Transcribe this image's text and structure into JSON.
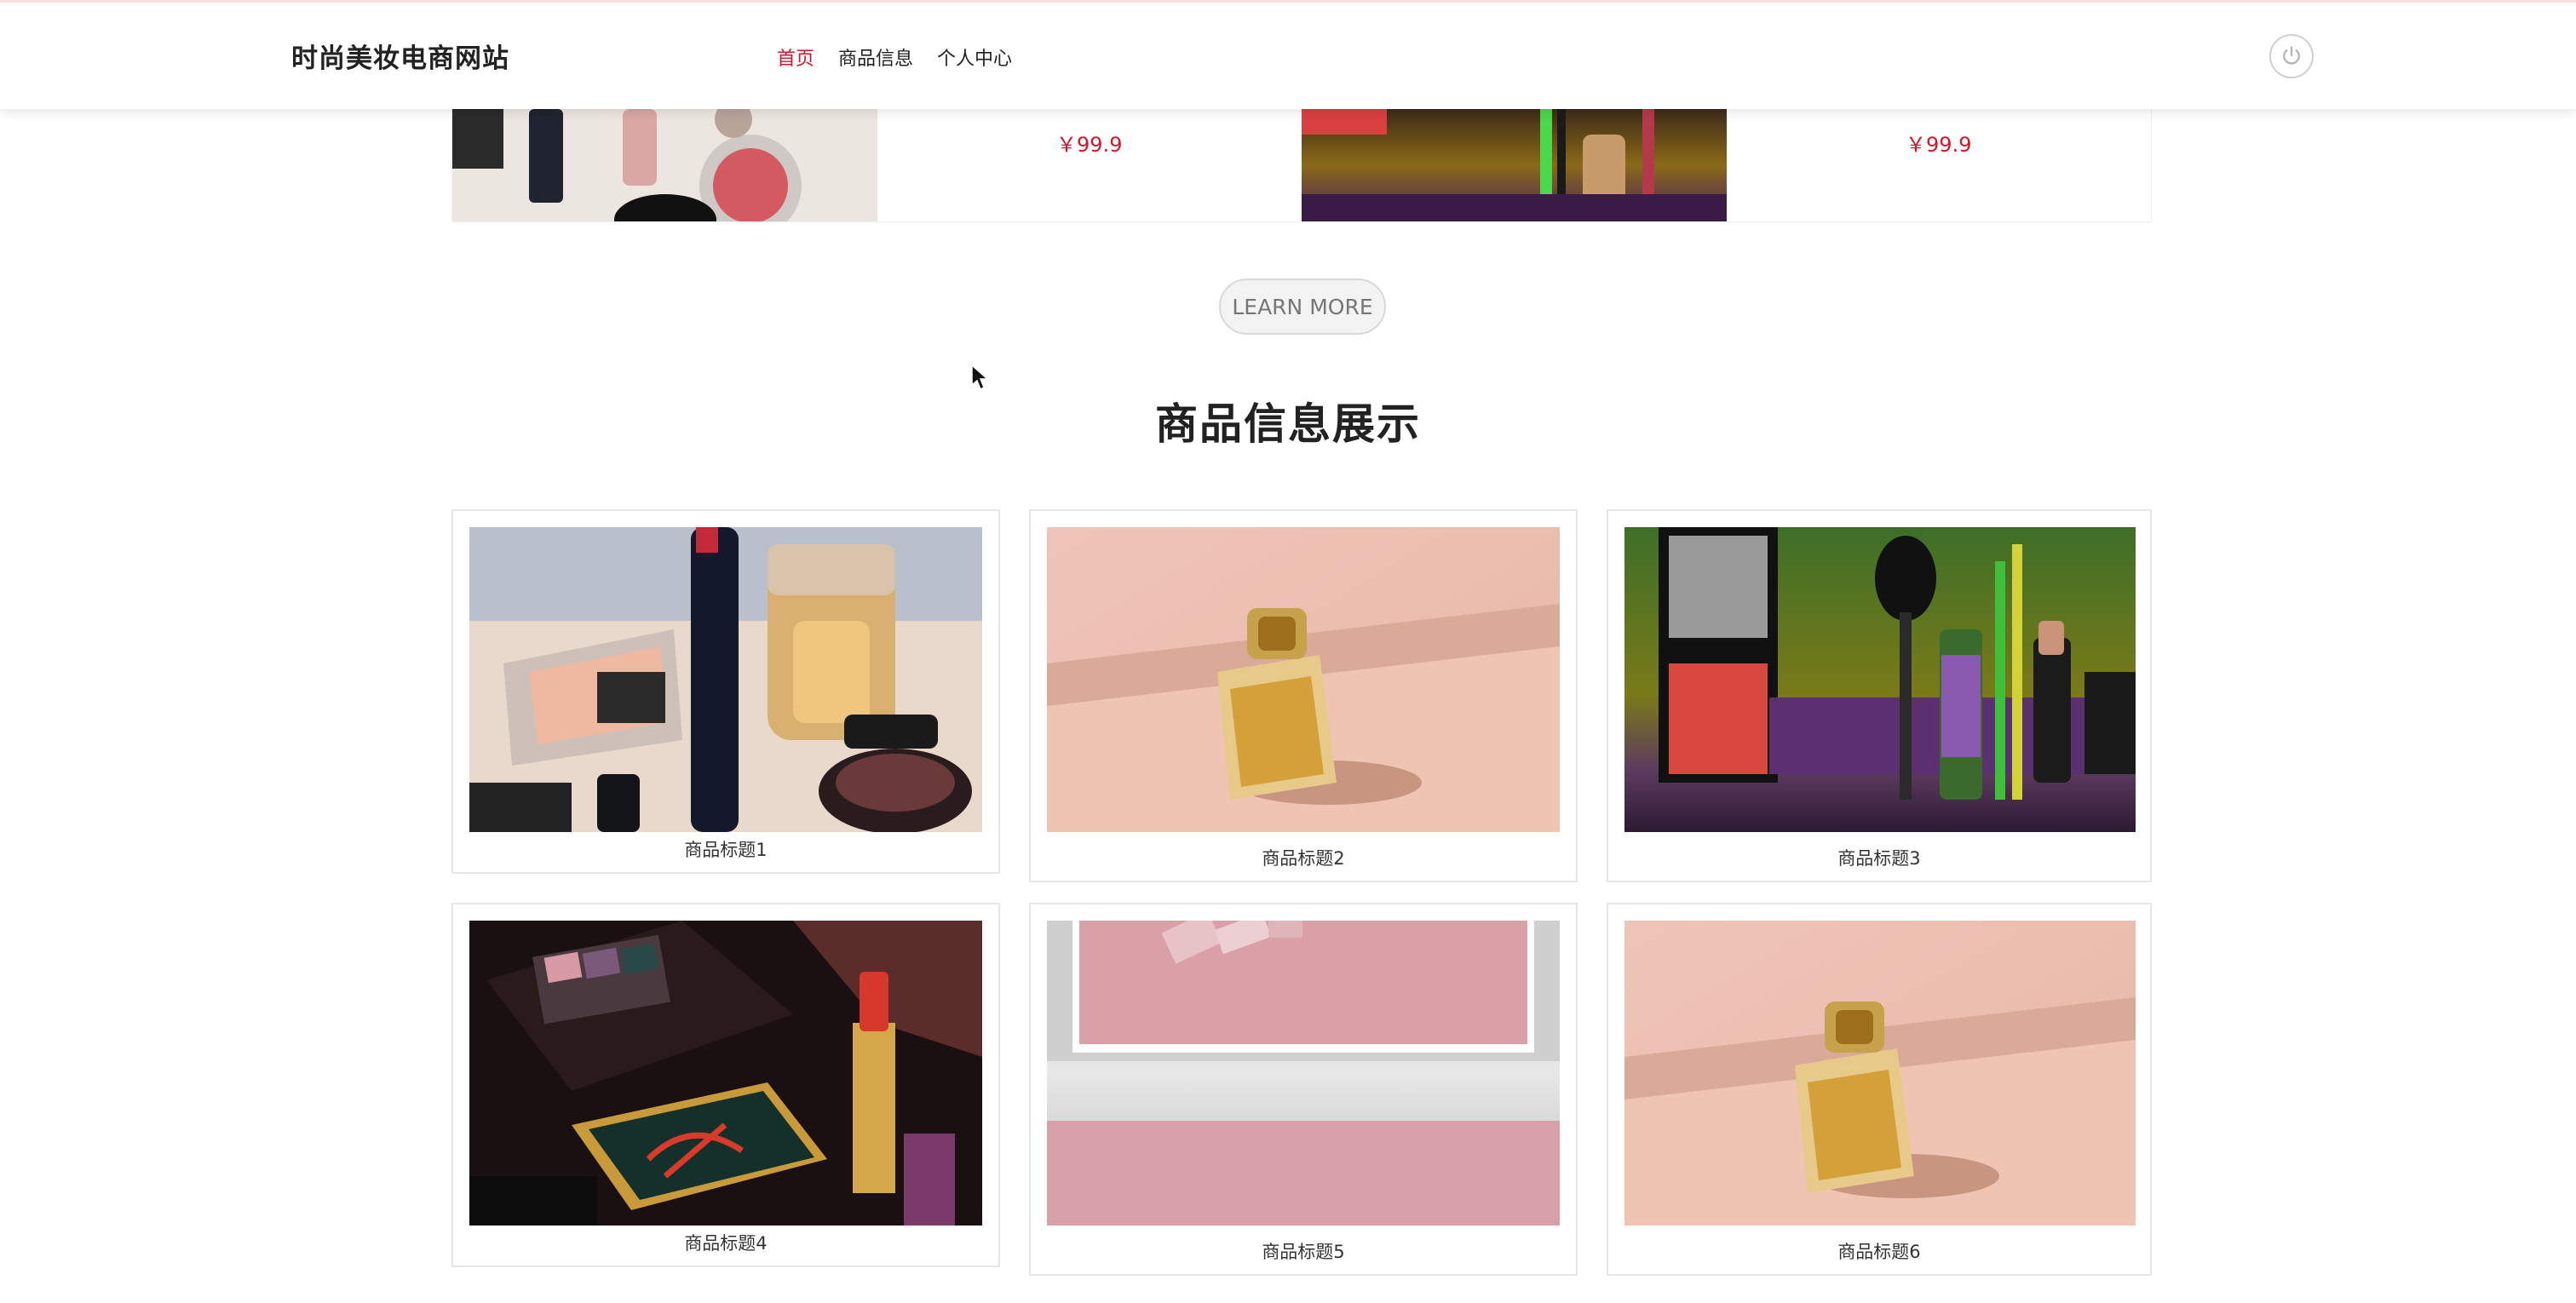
{
  "header": {
    "site_title": "时尚美妆电商网站",
    "nav": [
      {
        "label": "首页",
        "active": true
      },
      {
        "label": "商品信息",
        "active": false
      },
      {
        "label": "个人中心",
        "active": false
      }
    ],
    "power_icon": "power-icon"
  },
  "strip": {
    "prices": [
      "￥99.9",
      "￥99.9"
    ]
  },
  "learn_more_label": "LEARN MORE",
  "section_title": "商品信息展示",
  "products": [
    {
      "title": "商品标题1",
      "image": "cosmetics-flatlay"
    },
    {
      "title": "商品标题2",
      "image": "perfume-bottle"
    },
    {
      "title": "商品标题3",
      "image": "blush-and-brushes"
    },
    {
      "title": "商品标题4",
      "image": "ysl-palette-lipstick"
    },
    {
      "title": "商品标题5",
      "image": "pink-lipsticks"
    },
    {
      "title": "商品标题6",
      "image": "perfume-bottle"
    }
  ],
  "colors": {
    "accent": "#d4152b",
    "text": "#222222",
    "border": "#e6e6e6"
  }
}
